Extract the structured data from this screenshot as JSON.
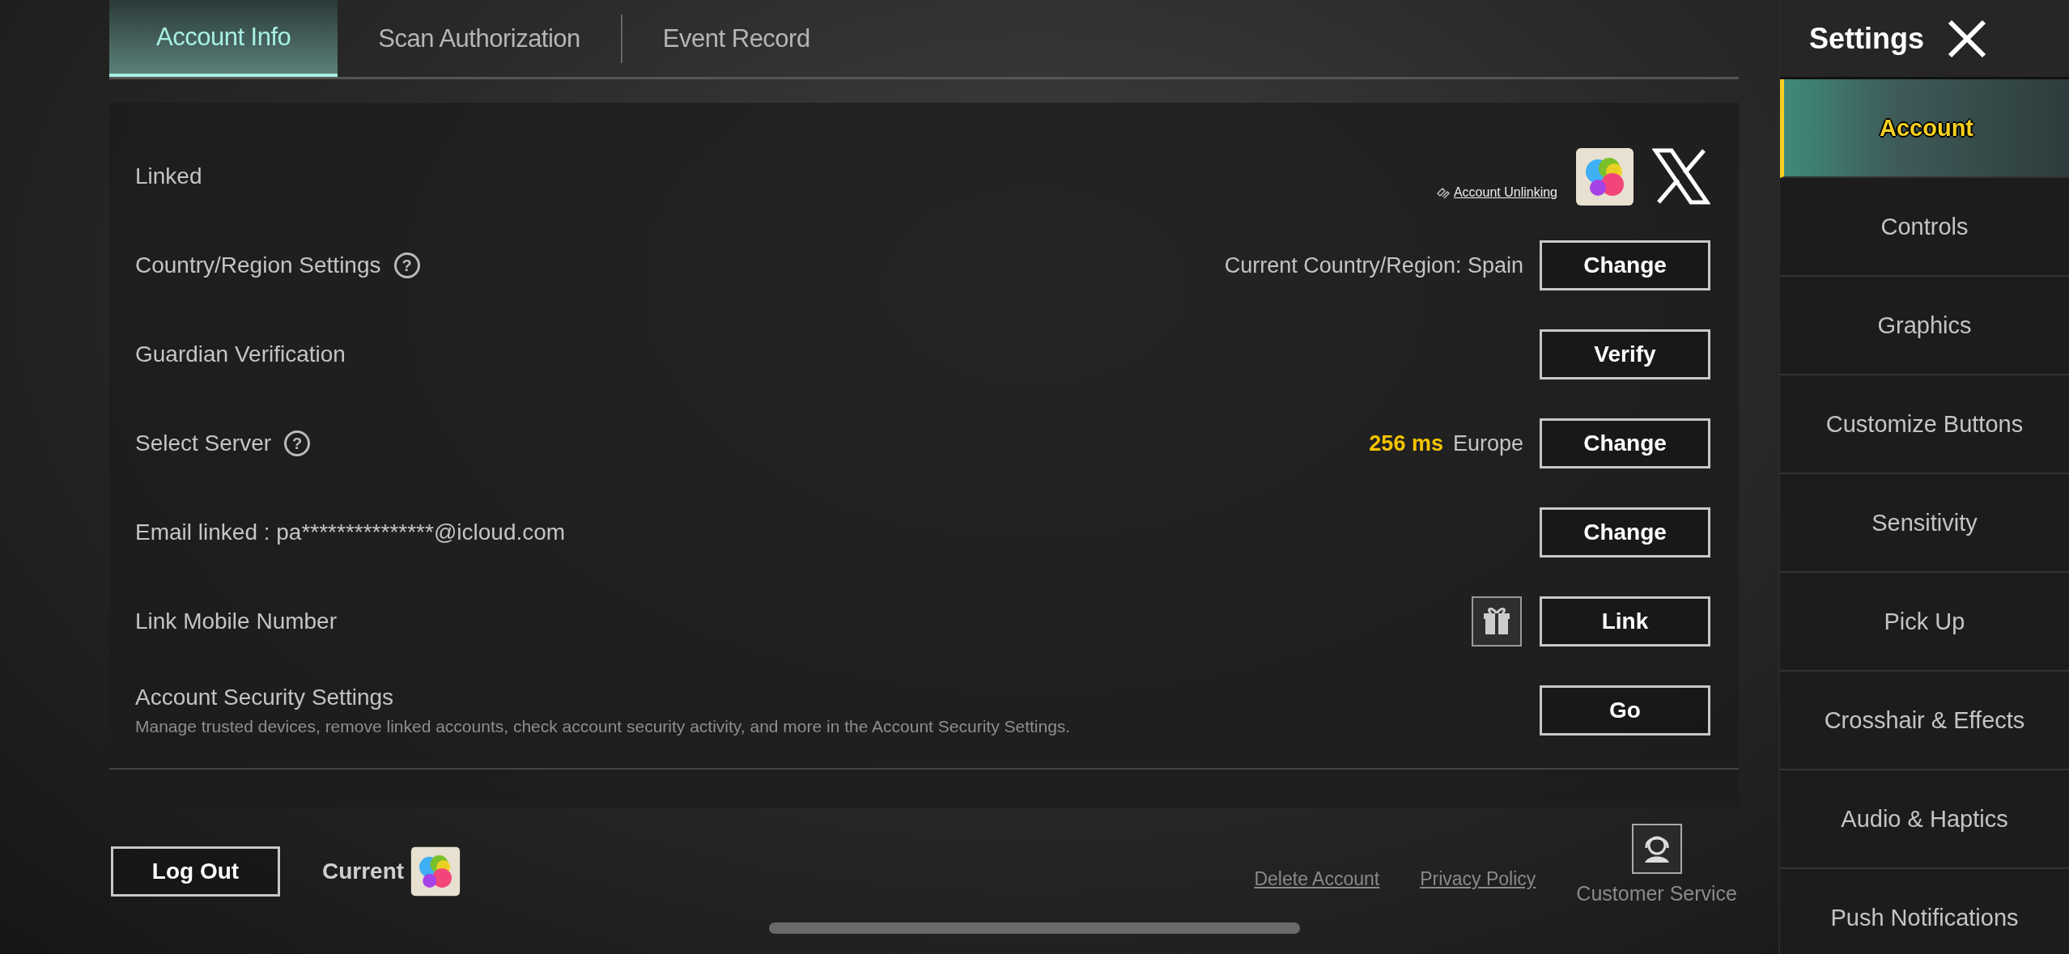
{
  "tabs": [
    {
      "label": "Account Info",
      "selected": true
    },
    {
      "label": "Scan Authorization",
      "selected": false
    },
    {
      "label": "Event Record",
      "selected": false
    }
  ],
  "rows": [
    {
      "kind": "linked",
      "label": "Linked",
      "link": "Account Unlinking"
    },
    {
      "kind": "action",
      "label": "Country/Region Settings",
      "help": "?",
      "value": "Current Country/Region: Spain",
      "button": "Change"
    },
    {
      "kind": "action",
      "label": "Guardian Verification",
      "button": "Verify"
    },
    {
      "kind": "server",
      "label": "Select Server",
      "help": "?",
      "ping": "256 ms",
      "region": "Europe",
      "button": "Change"
    },
    {
      "kind": "action",
      "label": "Email linked : pa***************@icloud.com",
      "button": "Change"
    },
    {
      "kind": "action",
      "label": "Link Mobile Number",
      "gift": true,
      "button": "Link"
    },
    {
      "kind": "security",
      "label": "Account Security Settings",
      "description": "Manage trusted devices, remove linked accounts, check account security activity, and more in the Account Security Settings.",
      "button": "Go"
    }
  ],
  "footer": {
    "logout": "Log Out",
    "current": "Current",
    "links": [
      "Delete Account",
      "Privacy Policy"
    ],
    "service": "Customer Service"
  },
  "sidebar": {
    "title": "Settings",
    "items": [
      {
        "label": "Account",
        "selected": true
      },
      {
        "label": "Controls",
        "selected": false
      },
      {
        "label": "Graphics",
        "selected": false
      },
      {
        "label": "Customize Buttons",
        "selected": false
      },
      {
        "label": "Sensitivity",
        "selected": false
      },
      {
        "label": "Pick Up",
        "selected": false
      },
      {
        "label": "Crosshair & Effects",
        "selected": false
      },
      {
        "label": "Audio & Haptics",
        "selected": false
      },
      {
        "label": "Push Notifications",
        "selected": false
      }
    ]
  }
}
